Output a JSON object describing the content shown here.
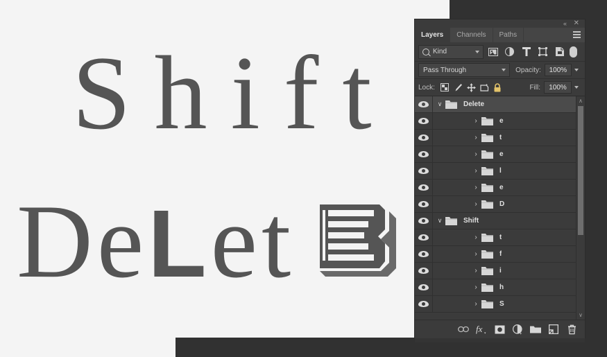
{
  "canvas": {
    "background_color": "#f4f4f4",
    "text_color": "#555555",
    "artwork": {
      "line1": "Shift",
      "line2_prefix": "De",
      "line2_l": "L",
      "line2_mid": "et",
      "line2_final_glyph": "E",
      "final_glyph_style": "inline-outline-slab-serif-with-drop-shadow"
    }
  },
  "panel": {
    "titlebar": {
      "collapse_label": "«",
      "close_label": "✕",
      "collapse_icon": "double-chevron-left-icon",
      "close_icon": "close-icon"
    },
    "tabs": [
      {
        "label": "Layers",
        "active": true
      },
      {
        "label": "Channels",
        "active": false
      },
      {
        "label": "Paths",
        "active": false
      }
    ],
    "menu_icon": "panel-menu-icon",
    "filter": {
      "kind_label": "Kind",
      "search_icon": "search-icon",
      "icons": [
        "image-filter-icon",
        "adjustment-filter-icon",
        "type-filter-icon",
        "shape-filter-icon",
        "smart-object-filter-icon"
      ],
      "toggle_icon": "filter-toggle-switch"
    },
    "blend": {
      "mode": "Pass Through",
      "opacity_label": "Opacity:",
      "opacity_value": "100%"
    },
    "lock": {
      "label": "Lock:",
      "icons": [
        "lock-transparent-pixels-icon",
        "lock-image-pixels-icon",
        "lock-position-icon",
        "lock-artboard-nesting-icon",
        "lock-all-icon"
      ],
      "fill_label": "Fill:",
      "fill_value": "100%"
    },
    "layers": [
      {
        "name": "Delete",
        "type": "group",
        "depth": 0,
        "expanded": true,
        "selected": true,
        "visible": true
      },
      {
        "name": "e",
        "type": "group",
        "depth": 1,
        "expanded": false,
        "selected": false,
        "visible": true
      },
      {
        "name": "t",
        "type": "group",
        "depth": 1,
        "expanded": false,
        "selected": false,
        "visible": true
      },
      {
        "name": "e",
        "type": "group",
        "depth": 1,
        "expanded": false,
        "selected": false,
        "visible": true
      },
      {
        "name": "l",
        "type": "group",
        "depth": 1,
        "expanded": false,
        "selected": false,
        "visible": true
      },
      {
        "name": "e",
        "type": "group",
        "depth": 1,
        "expanded": false,
        "selected": false,
        "visible": true
      },
      {
        "name": "D",
        "type": "group",
        "depth": 1,
        "expanded": false,
        "selected": false,
        "visible": true
      },
      {
        "name": "Shift",
        "type": "group",
        "depth": 0,
        "expanded": true,
        "selected": false,
        "visible": true
      },
      {
        "name": "t",
        "type": "group",
        "depth": 1,
        "expanded": false,
        "selected": false,
        "visible": true
      },
      {
        "name": "f",
        "type": "group",
        "depth": 1,
        "expanded": false,
        "selected": false,
        "visible": true
      },
      {
        "name": "i",
        "type": "group",
        "depth": 1,
        "expanded": false,
        "selected": false,
        "visible": true
      },
      {
        "name": "h",
        "type": "group",
        "depth": 1,
        "expanded": false,
        "selected": false,
        "visible": true
      },
      {
        "name": "S",
        "type": "group",
        "depth": 1,
        "expanded": false,
        "selected": false,
        "visible": true
      }
    ],
    "scrollbar": {
      "up_arrow": "∧",
      "down_arrow": "∨"
    },
    "footer_icons": [
      "link-layers-icon",
      "layer-styles-fx-icon",
      "add-layer-mask-icon",
      "new-adjustment-layer-icon",
      "new-group-icon",
      "new-layer-icon",
      "delete-layer-icon"
    ],
    "colors": {
      "panel_bg": "#3b3b3b",
      "tab_bg": "#454545",
      "row_selected": "#4b4b4b",
      "field_bg": "#454545",
      "text": "#e0e0e0",
      "backdrop": "#313131"
    }
  }
}
